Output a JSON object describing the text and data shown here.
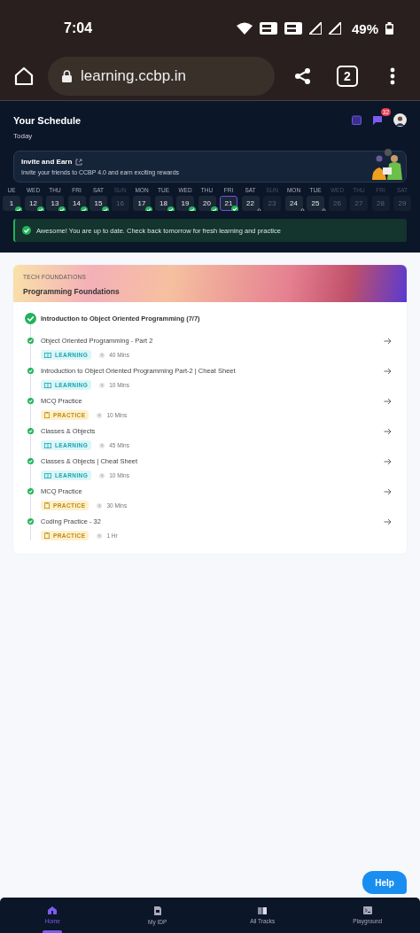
{
  "status_bar": {
    "time": "7:04",
    "battery": "49%"
  },
  "browser": {
    "url": "learning.ccbp.in",
    "tab_count": "2"
  },
  "header": {
    "title": "Your Schedule",
    "subtitle": "Today",
    "notification_count": "32"
  },
  "invite": {
    "title": "Invite and Earn",
    "text": "Invite your friends to CCBP 4.0 and earn exciting rewards"
  },
  "days": [
    {
      "day": "UE",
      "date": "1",
      "done": true,
      "locked": false,
      "disabled": false,
      "selected": false
    },
    {
      "day": "WED",
      "date": "12",
      "done": true,
      "locked": false,
      "disabled": false,
      "selected": false
    },
    {
      "day": "THU",
      "date": "13",
      "done": true,
      "locked": false,
      "disabled": false,
      "selected": false
    },
    {
      "day": "FRI",
      "date": "14",
      "done": true,
      "locked": false,
      "disabled": false,
      "selected": false
    },
    {
      "day": "SAT",
      "date": "15",
      "done": true,
      "locked": false,
      "disabled": false,
      "selected": false
    },
    {
      "day": "SUN",
      "date": "16",
      "done": false,
      "locked": false,
      "disabled": true,
      "selected": false
    },
    {
      "day": "MON",
      "date": "17",
      "done": true,
      "locked": false,
      "disabled": false,
      "selected": false
    },
    {
      "day": "TUE",
      "date": "18",
      "done": true,
      "locked": false,
      "disabled": false,
      "selected": false
    },
    {
      "day": "WED",
      "date": "19",
      "done": true,
      "locked": false,
      "disabled": false,
      "selected": false
    },
    {
      "day": "THU",
      "date": "20",
      "done": true,
      "locked": false,
      "disabled": false,
      "selected": false
    },
    {
      "day": "FRI",
      "date": "21",
      "done": true,
      "locked": false,
      "disabled": false,
      "selected": true
    },
    {
      "day": "SAT",
      "date": "22",
      "done": false,
      "locked": true,
      "disabled": false,
      "selected": false
    },
    {
      "day": "SUN",
      "date": "23",
      "done": false,
      "locked": false,
      "disabled": true,
      "selected": false
    },
    {
      "day": "MON",
      "date": "24",
      "done": false,
      "locked": true,
      "disabled": false,
      "selected": false
    },
    {
      "day": "TUE",
      "date": "25",
      "done": false,
      "locked": true,
      "disabled": false,
      "selected": false
    },
    {
      "day": "WED",
      "date": "26",
      "done": false,
      "locked": false,
      "disabled": true,
      "selected": false
    },
    {
      "day": "THU",
      "date": "27",
      "done": false,
      "locked": false,
      "disabled": true,
      "selected": false
    },
    {
      "day": "FRI",
      "date": "28",
      "done": false,
      "locked": false,
      "disabled": true,
      "selected": false
    },
    {
      "day": "SAT",
      "date": "29",
      "done": false,
      "locked": false,
      "disabled": true,
      "selected": false
    }
  ],
  "alert": "Awesome! You are up to date. Check back tomorrow for fresh learning and practice",
  "course": {
    "track": "TECH FOUNDATIONS",
    "title": "Programming Foundations",
    "topic": "Introduction to Object Oriented Programming (7/7)",
    "topic_done": true,
    "items": [
      {
        "title": "Object Oriented Programming - Part 2",
        "kind": "learning",
        "tag": "LEARNING",
        "duration": "40 Mins",
        "done": true
      },
      {
        "title": "Introduction to Object Oriented Programming Part-2 | Cheat Sheet",
        "kind": "learning",
        "tag": "LEARNING",
        "duration": "10 Mins",
        "done": true
      },
      {
        "title": "MCQ Practice",
        "kind": "practice",
        "tag": "PRACTICE",
        "duration": "10 Mins",
        "done": true
      },
      {
        "title": "Classes & Objects",
        "kind": "learning",
        "tag": "LEARNING",
        "duration": "45 Mins",
        "done": true
      },
      {
        "title": "Classes & Objects | Cheat Sheet",
        "kind": "learning",
        "tag": "LEARNING",
        "duration": "10 Mins",
        "done": true
      },
      {
        "title": "MCQ Practice",
        "kind": "practice",
        "tag": "PRACTICE",
        "duration": "30 Mins",
        "done": true
      },
      {
        "title": "Coding Practice - 32",
        "kind": "practice",
        "tag": "PRACTICE",
        "duration": "1 Hr",
        "done": true
      }
    ]
  },
  "help": "Help",
  "nav": [
    {
      "label": "Home",
      "kind": "home",
      "selected": true
    },
    {
      "label": "My IDP",
      "kind": "doc",
      "selected": false
    },
    {
      "label": "All Tracks",
      "kind": "book",
      "selected": false
    },
    {
      "label": "Playground",
      "kind": "terminal",
      "selected": false
    }
  ]
}
